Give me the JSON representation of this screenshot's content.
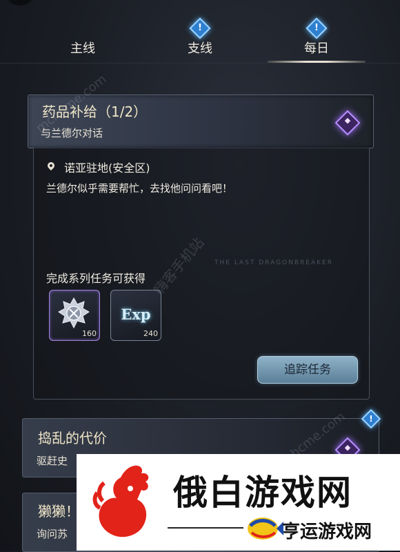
{
  "tabs": [
    {
      "label": "主线",
      "alert": false
    },
    {
      "label": "支线",
      "alert": true
    },
    {
      "label": "每日",
      "alert": true,
      "active": true
    }
  ],
  "alert_glyph": "!",
  "active_quest": {
    "title": "药品补给（1/2）",
    "subtitle": "与兰德尔对话",
    "location": "诺亚驻地(安全区)",
    "description": "兰德尔似乎需要帮忙，去找他问问看吧！",
    "deco_text": "THE LAST DRAGONBREAKER",
    "rewards_title": "完成系列任务可获得",
    "rewards": [
      {
        "icon": "medal-icon",
        "count": "160"
      },
      {
        "icon": "exp-icon",
        "label": "Exp",
        "count": "240"
      }
    ],
    "track_button": "追踪任务"
  },
  "quest2": {
    "title": "捣乱的代价",
    "subtitle": "驱赶史"
  },
  "quest3": {
    "title": "獭獭！",
    "subtitle": "询问苏"
  },
  "watermarks": [
    "mchume.com",
    "嗨客手机站",
    "hcme.com"
  ],
  "banner": {
    "brand": "俄白游戏网",
    "slogan": "亨运游戏网"
  },
  "colors": {
    "accent_blue": "#2f7fd0",
    "accent_purple": "#b890ff",
    "button": "#7c9fb6"
  }
}
